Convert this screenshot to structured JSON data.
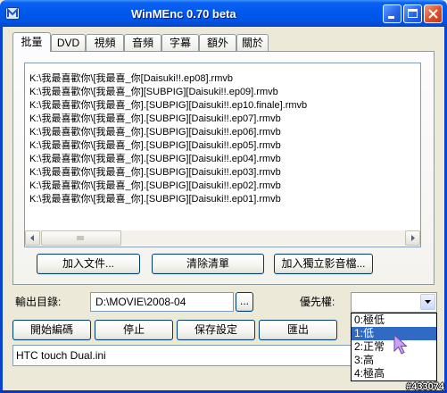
{
  "window": {
    "title": "WinMEnc 0.70 beta"
  },
  "tabs": [
    {
      "label": "批量",
      "selected": true
    },
    {
      "label": "DVD",
      "selected": false
    },
    {
      "label": "視頻",
      "selected": false
    },
    {
      "label": "音頻",
      "selected": false
    },
    {
      "label": "字幕",
      "selected": false
    },
    {
      "label": "額外",
      "selected": false
    },
    {
      "label": "關於",
      "selected": false
    }
  ],
  "file_list": {
    "items": [
      "K:\\我最喜歡你\\[我最喜_你[Daisuki!!.ep08].rmvb",
      "K:\\我最喜歡你\\[我最喜_你][SUBPIG][Daisuki!!.ep09].rmvb",
      "K:\\我最喜歡你\\[我最喜_你].[SUBPIG][Daisuki!!.ep10.finale].rmvb",
      "K:\\我最喜歡你\\[我最喜_你].[SUBPIG][Daisuki!!.ep07].rmvb",
      "K:\\我最喜歡你\\[我最喜_你].[SUBPIG][Daisuki!!.ep06].rmvb",
      "K:\\我最喜歡你\\[我最喜_你].[SUBPIG][Daisuki!!.ep05].rmvb",
      "K:\\我最喜歡你\\[我最喜_你].[SUBPIG][Daisuki!!.ep04].rmvb",
      "K:\\我最喜歡你\\[我最喜_你].[SUBPIG][Daisuki!!.ep03].rmvb",
      "K:\\我最喜歡你\\[我最喜_你].[SUBPIG][Daisuki!!.ep02].rmvb",
      "K:\\我最喜歡你\\[我最喜_你].[SUBPIG][Daisuki!!.ep01].rmvb"
    ]
  },
  "list_buttons": {
    "add_files": "加入文件...",
    "clear_list": "清除清單",
    "add_standalone": "加入獨立影音檔..."
  },
  "output_dir": {
    "label": "輸出目錄:",
    "value": "D:\\MOVIE\\2008-04",
    "browse_label": "..."
  },
  "priority": {
    "label": "優先權:",
    "value": "",
    "options": [
      {
        "label": "0:極低",
        "highlighted": false
      },
      {
        "label": "1:低",
        "highlighted": true
      },
      {
        "label": "2:正常",
        "highlighted": false
      },
      {
        "label": "3:高",
        "highlighted": false
      },
      {
        "label": "4:極高",
        "highlighted": false
      }
    ]
  },
  "actions": {
    "start": "開始編碼",
    "stop": "停止",
    "save": "保存設定",
    "export": "匯出"
  },
  "profile": {
    "value": "HTC touch Dual.ini"
  },
  "watermark": "#433074",
  "colors": {
    "titlebar": "#0058EE",
    "window_bg": "#ECE9D8",
    "selection": "#316AC5",
    "field_border": "#7F9DB9",
    "button_border": "#003C74",
    "close_button": "#D9502A",
    "cursor": "#C9A2F2"
  },
  "icons": [
    "app-icon",
    "minimize-icon",
    "maximize-icon",
    "close-icon",
    "arrow-left-icon",
    "arrow-right-icon",
    "scroll-grip-icon",
    "chevron-down-icon",
    "mouse-cursor-icon"
  ]
}
